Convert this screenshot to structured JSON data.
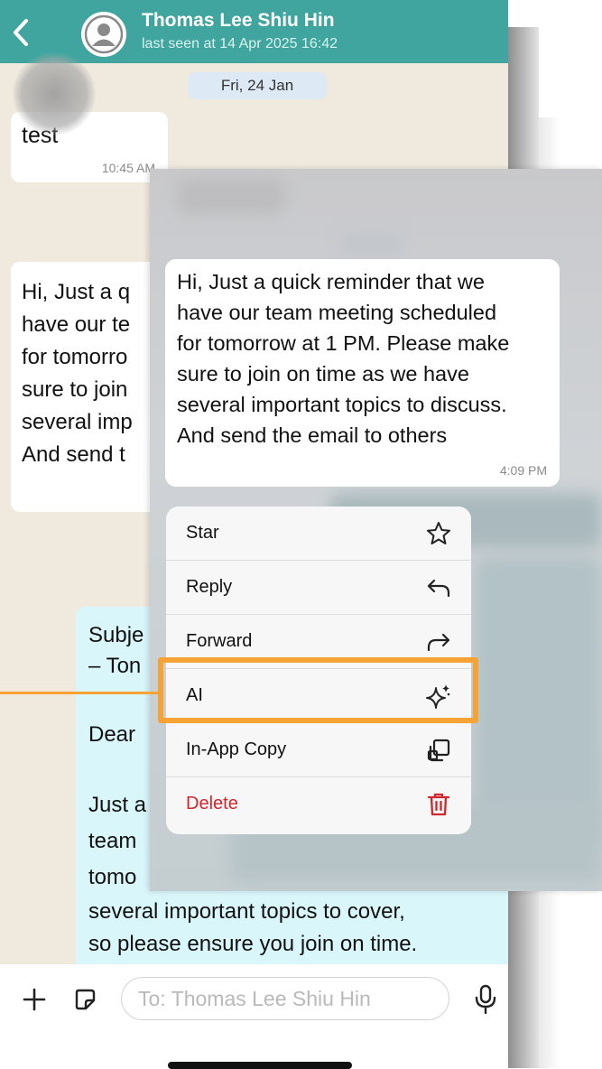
{
  "colors": {
    "header": "#3fa59e",
    "chat_bg": "#efe9de",
    "outgoing_bubble": "#d9f6fb",
    "highlight": "#f6a336",
    "delete": "#d0262d"
  },
  "header": {
    "back_icon": "chevron-left-icon",
    "avatar_icon": "person-icon",
    "contact_name": "Thomas Lee Shiu Hin",
    "last_seen": "last seen at 14 Apr 2025 16:42"
  },
  "chat": {
    "date_chip": "Fri, 24 Jan",
    "msg_test": {
      "text": "test",
      "time": "10:45 AM"
    },
    "reminder_partial_lines": [
      "Hi, Just a q",
      "have our te",
      "for tomorro",
      "sure to join",
      "several imp",
      "And send t"
    ],
    "reply_partial_lines": [
      "Subje",
      "– Ton",
      "Dear",
      "Just a",
      "team",
      "tomo",
      "several important topics to cover,",
      "so please ensure you join on time."
    ]
  },
  "composer": {
    "plus_icon": "plus-icon",
    "sticker_icon": "sticker-icon",
    "placeholder": "To: Thomas Lee Shiu Hin",
    "mic_icon": "microphone-icon"
  },
  "focused_message": {
    "lines": [
      "Hi, Just a quick reminder that we",
      "have our team meeting scheduled",
      "for tomorrow at 1 PM. Please make",
      "sure to join on time as we have",
      "several important topics to discuss.",
      "And send the email to others"
    ],
    "time": "4:09 PM"
  },
  "context_menu": {
    "items": [
      {
        "label": "Star",
        "icon": "star-icon"
      },
      {
        "label": "Reply",
        "icon": "reply-arrow-icon"
      },
      {
        "label": "Forward",
        "icon": "forward-arrow-icon"
      },
      {
        "label": "AI",
        "icon": "sparkle-icon"
      },
      {
        "label": "In-App Copy",
        "icon": "copy-icon"
      },
      {
        "label": "Delete",
        "icon": "trash-icon"
      }
    ]
  }
}
